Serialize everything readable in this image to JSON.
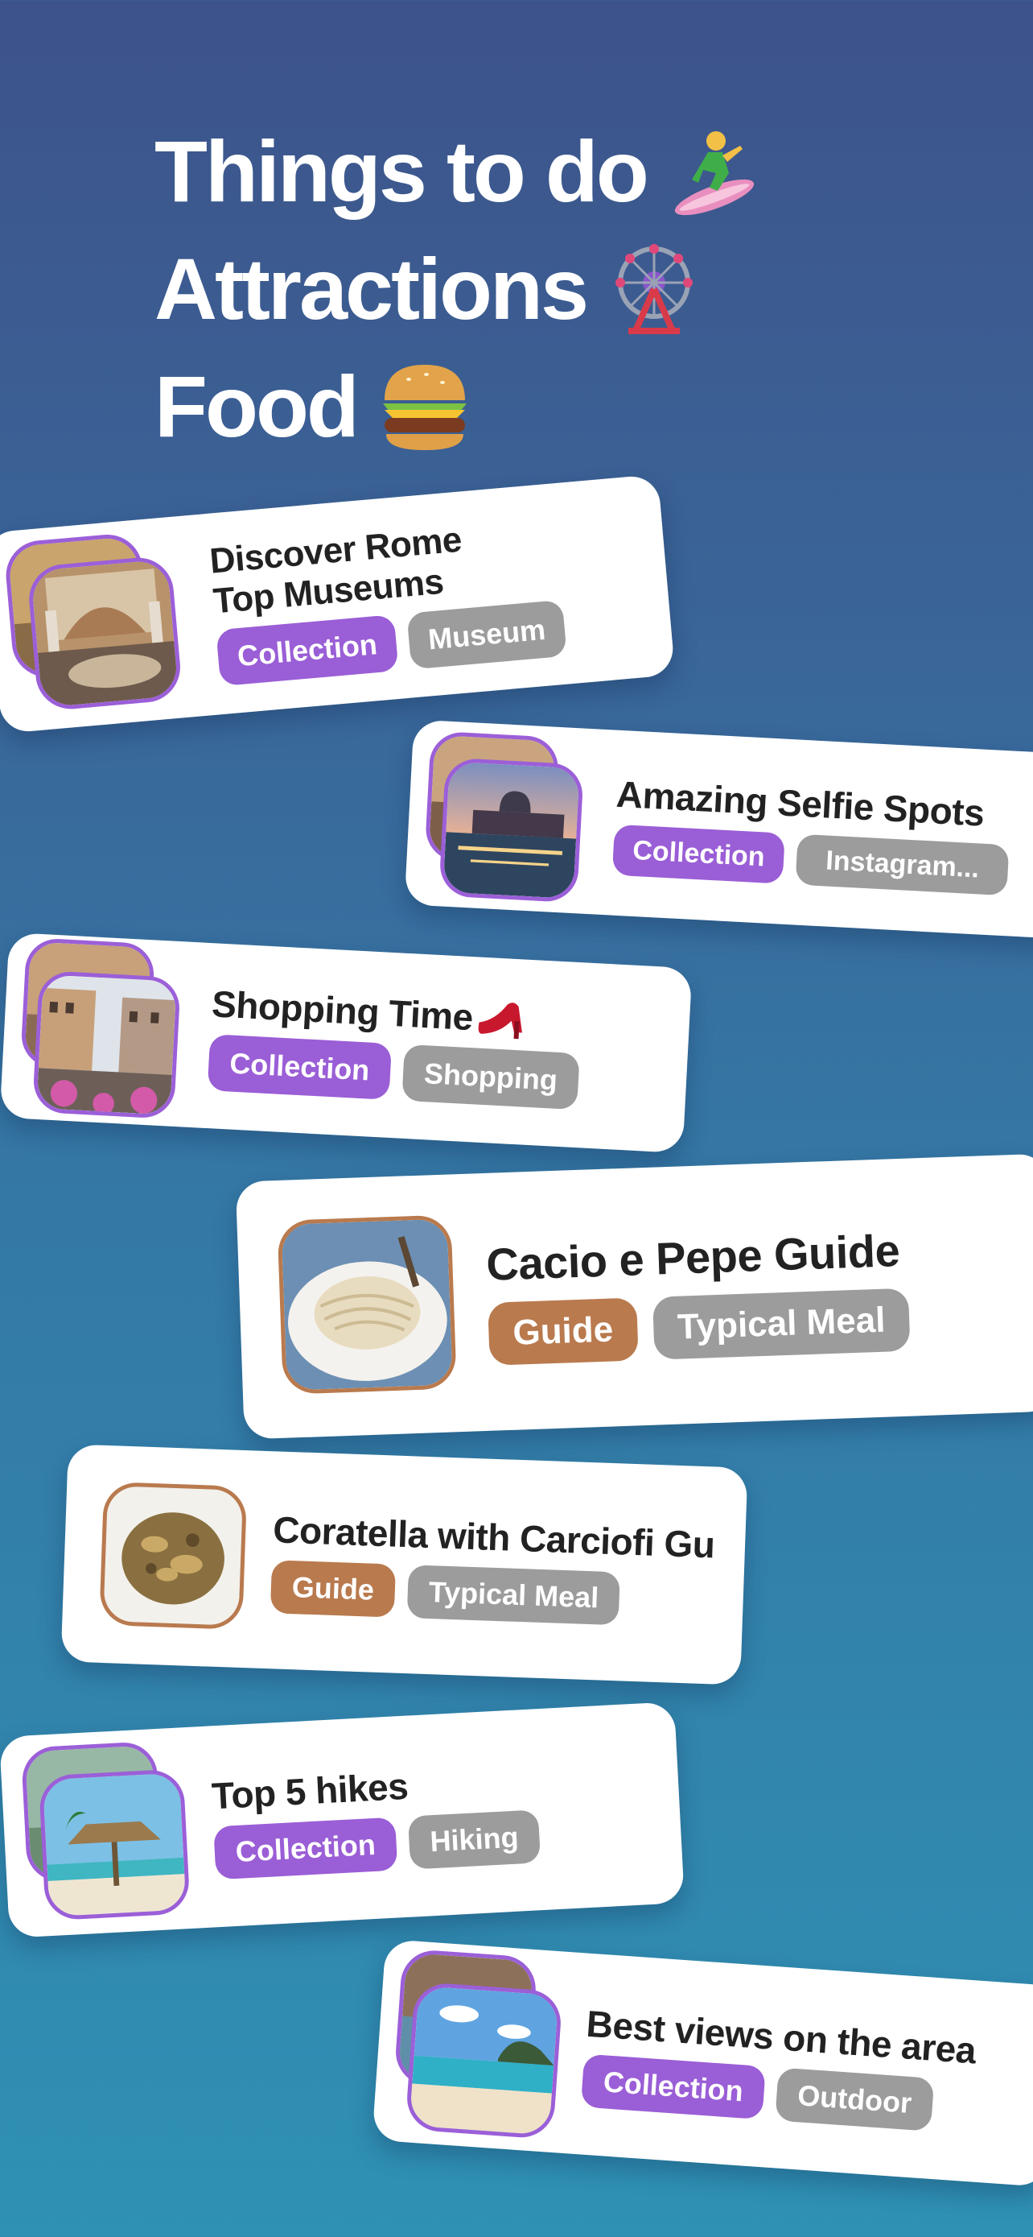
{
  "headline": {
    "line1": "Things to do",
    "line2": "Attractions",
    "line3": "Food"
  },
  "colors": {
    "collection": "#9a5ed6",
    "guide": "#b97a4e",
    "category": "#9c9c9c"
  },
  "cards": [
    {
      "title1": "Discover Rome",
      "title2": "Top Museums",
      "type": "Collection",
      "category": "Museum"
    },
    {
      "title": "Amazing Selfie Spots",
      "type": "Collection",
      "category": "Instagram..."
    },
    {
      "title": "Shopping Time",
      "type": "Collection",
      "category": "Shopping"
    },
    {
      "title": "Cacio e Pepe Guide",
      "type": "Guide",
      "category": "Typical Meal"
    },
    {
      "title": "Coratella with Carciofi Gu",
      "type": "Guide",
      "category": "Typical Meal"
    },
    {
      "title": "Top 5 hikes",
      "type": "Collection",
      "category": "Hiking"
    },
    {
      "title": "Best views on the area",
      "type": "Collection",
      "category": "Outdoor"
    }
  ]
}
